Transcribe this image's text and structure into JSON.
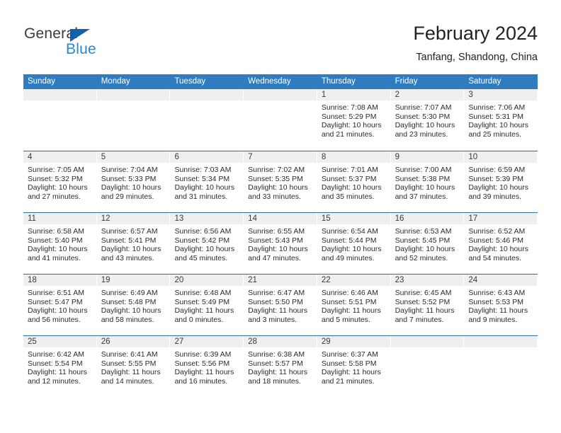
{
  "brand": {
    "name_primary": "General",
    "name_secondary": "Blue",
    "primary_color": "#3a3a3a",
    "secondary_color": "#2a87d8",
    "triangle_color": "#1161ab"
  },
  "header": {
    "month_title": "February 2024",
    "location": "Tanfang, Shandong, China"
  },
  "calendar": {
    "header_color": "#2f7dc0",
    "row_rule_color": "#2f6ead",
    "day_head_bg": "#efefef",
    "weekdays": [
      "Sunday",
      "Monday",
      "Tuesday",
      "Wednesday",
      "Thursday",
      "Friday",
      "Saturday"
    ],
    "weeks": [
      [
        {
          "date": "",
          "lines": []
        },
        {
          "date": "",
          "lines": []
        },
        {
          "date": "",
          "lines": []
        },
        {
          "date": "",
          "lines": []
        },
        {
          "date": "1",
          "lines": [
            "Sunrise: 7:08 AM",
            "Sunset: 5:29 PM",
            "Daylight: 10 hours",
            "and 21 minutes."
          ]
        },
        {
          "date": "2",
          "lines": [
            "Sunrise: 7:07 AM",
            "Sunset: 5:30 PM",
            "Daylight: 10 hours",
            "and 23 minutes."
          ]
        },
        {
          "date": "3",
          "lines": [
            "Sunrise: 7:06 AM",
            "Sunset: 5:31 PM",
            "Daylight: 10 hours",
            "and 25 minutes."
          ]
        }
      ],
      [
        {
          "date": "4",
          "lines": [
            "Sunrise: 7:05 AM",
            "Sunset: 5:32 PM",
            "Daylight: 10 hours",
            "and 27 minutes."
          ]
        },
        {
          "date": "5",
          "lines": [
            "Sunrise: 7:04 AM",
            "Sunset: 5:33 PM",
            "Daylight: 10 hours",
            "and 29 minutes."
          ]
        },
        {
          "date": "6",
          "lines": [
            "Sunrise: 7:03 AM",
            "Sunset: 5:34 PM",
            "Daylight: 10 hours",
            "and 31 minutes."
          ]
        },
        {
          "date": "7",
          "lines": [
            "Sunrise: 7:02 AM",
            "Sunset: 5:35 PM",
            "Daylight: 10 hours",
            "and 33 minutes."
          ]
        },
        {
          "date": "8",
          "lines": [
            "Sunrise: 7:01 AM",
            "Sunset: 5:37 PM",
            "Daylight: 10 hours",
            "and 35 minutes."
          ]
        },
        {
          "date": "9",
          "lines": [
            "Sunrise: 7:00 AM",
            "Sunset: 5:38 PM",
            "Daylight: 10 hours",
            "and 37 minutes."
          ]
        },
        {
          "date": "10",
          "lines": [
            "Sunrise: 6:59 AM",
            "Sunset: 5:39 PM",
            "Daylight: 10 hours",
            "and 39 minutes."
          ]
        }
      ],
      [
        {
          "date": "11",
          "lines": [
            "Sunrise: 6:58 AM",
            "Sunset: 5:40 PM",
            "Daylight: 10 hours",
            "and 41 minutes."
          ]
        },
        {
          "date": "12",
          "lines": [
            "Sunrise: 6:57 AM",
            "Sunset: 5:41 PM",
            "Daylight: 10 hours",
            "and 43 minutes."
          ]
        },
        {
          "date": "13",
          "lines": [
            "Sunrise: 6:56 AM",
            "Sunset: 5:42 PM",
            "Daylight: 10 hours",
            "and 45 minutes."
          ]
        },
        {
          "date": "14",
          "lines": [
            "Sunrise: 6:55 AM",
            "Sunset: 5:43 PM",
            "Daylight: 10 hours",
            "and 47 minutes."
          ]
        },
        {
          "date": "15",
          "lines": [
            "Sunrise: 6:54 AM",
            "Sunset: 5:44 PM",
            "Daylight: 10 hours",
            "and 49 minutes."
          ]
        },
        {
          "date": "16",
          "lines": [
            "Sunrise: 6:53 AM",
            "Sunset: 5:45 PM",
            "Daylight: 10 hours",
            "and 52 minutes."
          ]
        },
        {
          "date": "17",
          "lines": [
            "Sunrise: 6:52 AM",
            "Sunset: 5:46 PM",
            "Daylight: 10 hours",
            "and 54 minutes."
          ]
        }
      ],
      [
        {
          "date": "18",
          "lines": [
            "Sunrise: 6:51 AM",
            "Sunset: 5:47 PM",
            "Daylight: 10 hours",
            "and 56 minutes."
          ]
        },
        {
          "date": "19",
          "lines": [
            "Sunrise: 6:49 AM",
            "Sunset: 5:48 PM",
            "Daylight: 10 hours",
            "and 58 minutes."
          ]
        },
        {
          "date": "20",
          "lines": [
            "Sunrise: 6:48 AM",
            "Sunset: 5:49 PM",
            "Daylight: 11 hours",
            "and 0 minutes."
          ]
        },
        {
          "date": "21",
          "lines": [
            "Sunrise: 6:47 AM",
            "Sunset: 5:50 PM",
            "Daylight: 11 hours",
            "and 3 minutes."
          ]
        },
        {
          "date": "22",
          "lines": [
            "Sunrise: 6:46 AM",
            "Sunset: 5:51 PM",
            "Daylight: 11 hours",
            "and 5 minutes."
          ]
        },
        {
          "date": "23",
          "lines": [
            "Sunrise: 6:45 AM",
            "Sunset: 5:52 PM",
            "Daylight: 11 hours",
            "and 7 minutes."
          ]
        },
        {
          "date": "24",
          "lines": [
            "Sunrise: 6:43 AM",
            "Sunset: 5:53 PM",
            "Daylight: 11 hours",
            "and 9 minutes."
          ]
        }
      ],
      [
        {
          "date": "25",
          "lines": [
            "Sunrise: 6:42 AM",
            "Sunset: 5:54 PM",
            "Daylight: 11 hours",
            "and 12 minutes."
          ]
        },
        {
          "date": "26",
          "lines": [
            "Sunrise: 6:41 AM",
            "Sunset: 5:55 PM",
            "Daylight: 11 hours",
            "and 14 minutes."
          ]
        },
        {
          "date": "27",
          "lines": [
            "Sunrise: 6:39 AM",
            "Sunset: 5:56 PM",
            "Daylight: 11 hours",
            "and 16 minutes."
          ]
        },
        {
          "date": "28",
          "lines": [
            "Sunrise: 6:38 AM",
            "Sunset: 5:57 PM",
            "Daylight: 11 hours",
            "and 18 minutes."
          ]
        },
        {
          "date": "29",
          "lines": [
            "Sunrise: 6:37 AM",
            "Sunset: 5:58 PM",
            "Daylight: 11 hours",
            "and 21 minutes."
          ]
        },
        {
          "date": "",
          "lines": []
        },
        {
          "date": "",
          "lines": []
        }
      ]
    ]
  }
}
